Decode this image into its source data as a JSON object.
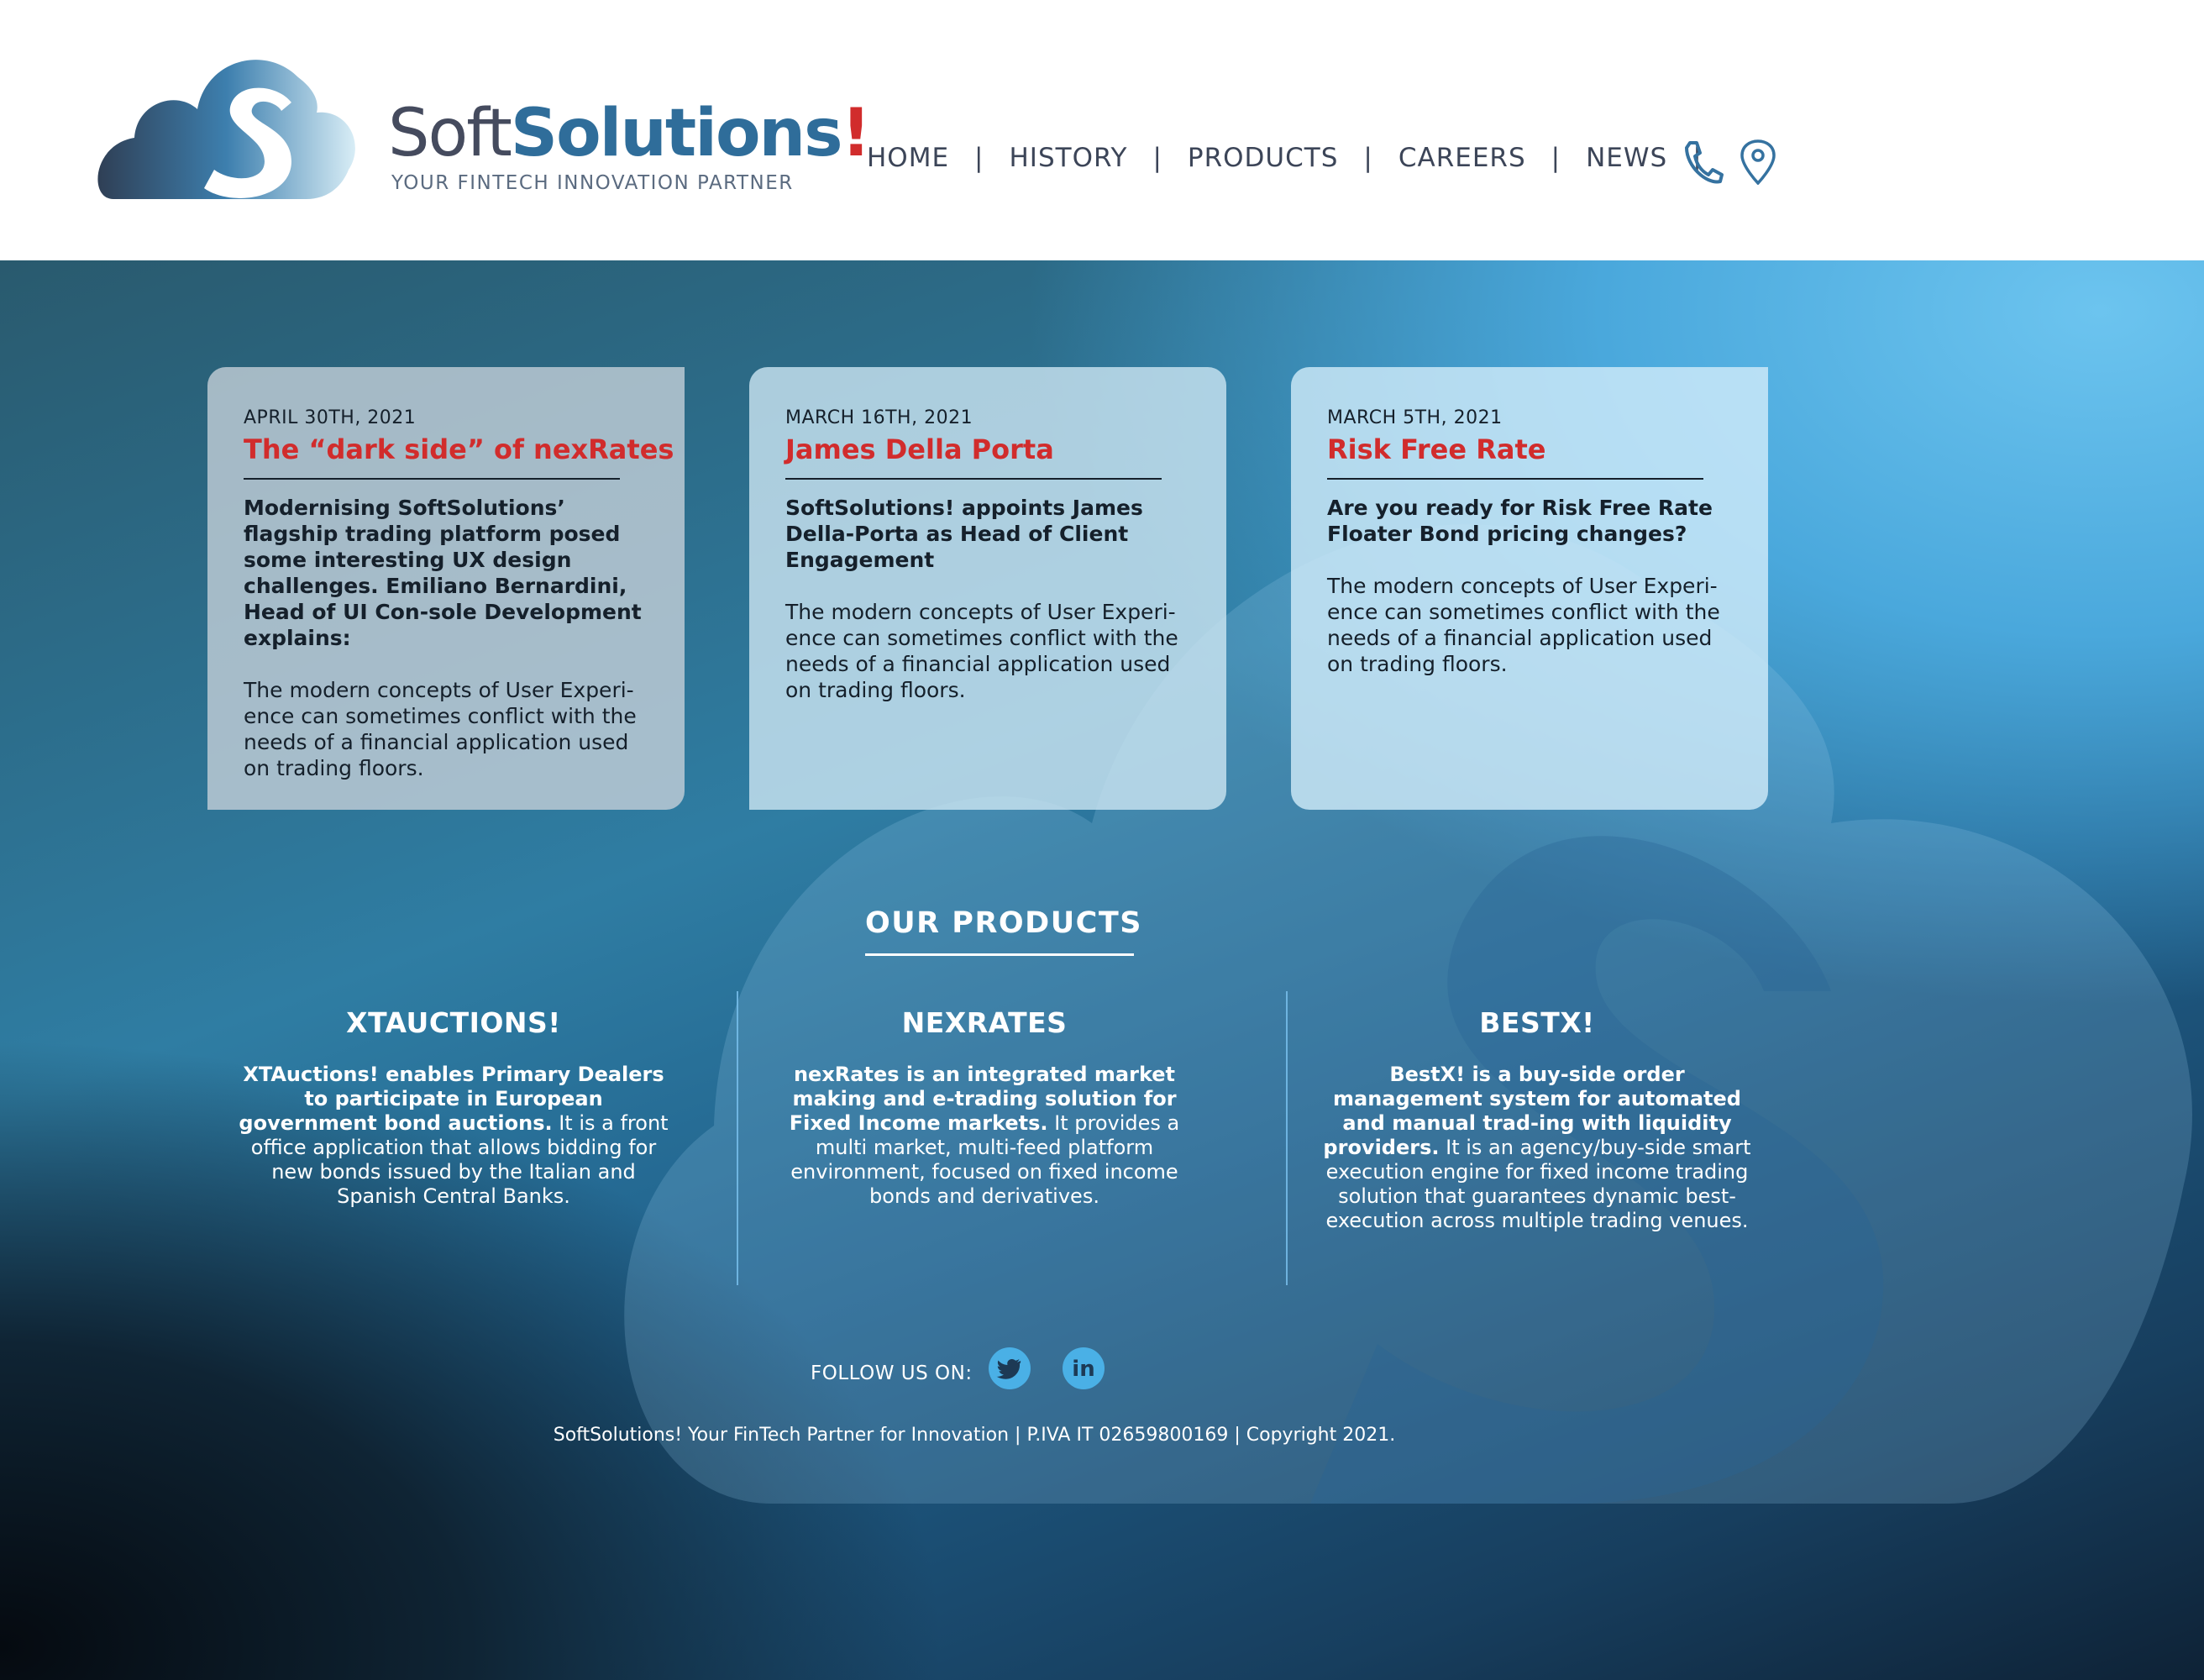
{
  "header": {
    "brand_soft": "Soft",
    "brand_solutions": "Solutions",
    "brand_bang": "!",
    "tagline": "YOUR FINTECH INNOVATION PARTNER",
    "nav": [
      {
        "label": "HOME"
      },
      {
        "label": "HISTORY"
      },
      {
        "label": "PRODUCTS"
      },
      {
        "label": "CAREERS"
      },
      {
        "label": "NEWS"
      }
    ],
    "separator": "|",
    "icons": [
      "phone-icon",
      "location-pin-icon"
    ]
  },
  "news": [
    {
      "date": "APRIL 30TH, 2021",
      "title": "The “dark side” of nexRates",
      "lead": "Modernising SoftSolutions’ flagship trading platform posed some interesting UX design challenges. Emiliano Bernardini, Head of UI Con-sole Development explains:",
      "body": "The modern concepts of User Experi-ence can sometimes conflict with the needs of a financial application used on trading floors."
    },
    {
      "date": "MARCH 16TH, 2021",
      "title": "James Della Porta",
      "lead": "SoftSolutions! appoints James Della-Porta as Head of Client Engagement",
      "body": "The modern concepts of User Experi-ence can sometimes conflict with the needs of a financial application used on trading floors."
    },
    {
      "date": "MARCH 5TH, 2021",
      "title": "Risk Free Rate",
      "lead": "Are you ready for Risk Free Rate Floater Bond pricing changes?",
      "body": "The modern concepts of User Experi-ence can sometimes conflict with the needs of a financial application used on trading floors."
    }
  ],
  "products_section": {
    "title": "OUR PRODUCTS",
    "items": [
      {
        "name": "XTAUCTIONS!",
        "bold": "XTAuctions! enables Primary Dealers to participate in European government bond auctions.",
        "text": " It is a front office application that allows bidding for new bonds issued by the Italian and Spanish Central Banks."
      },
      {
        "name": "NEXRATES",
        "bold": "nexRates is an integrated market making and e-trading solution for Fixed Income markets.",
        "text": " It provides a multi market, multi-feed platform environment, focused on fixed income bonds and derivatives."
      },
      {
        "name": "BESTX!",
        "bold": "BestX! is a buy-side order management system for automated and manual trad-ing with liquidity providers.",
        "text": " It is an agency/buy-side smart execution engine for fixed income trading solution that guarantees dynamic best-execution across multiple trading venues."
      }
    ]
  },
  "footer": {
    "follow_label": "FOLLOW US ON:",
    "social_icons": [
      "twitter-icon",
      "linkedin-icon"
    ],
    "linkedin_text": "in",
    "copyright": "SoftSolutions! Your FinTech Partner for Innovation | P.IVA IT 02659800169 | Copyright 2021."
  },
  "colors": {
    "brand_blue": "#2f6d9a",
    "brand_red": "#d12c2c",
    "nav_text": "#3c4558",
    "social_blue": "#4ab0e6"
  }
}
